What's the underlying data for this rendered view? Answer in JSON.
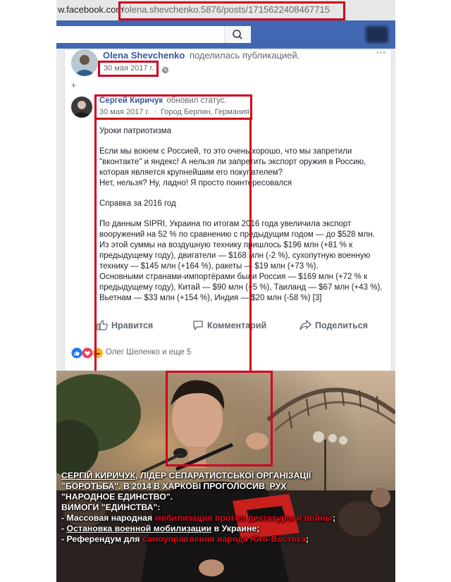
{
  "browser": {
    "url_host": "w.facebook.com",
    "url_path": "/olena.shevchenko.5876/posts/1715622408467715"
  },
  "share": {
    "author": "Olena Shevchenko",
    "action": "поделилась публикацией.",
    "date": "30 мая 2017 г.",
    "more": "···",
    "plus": "+"
  },
  "post": {
    "author": "Сергей Киричук",
    "action": "обновил статус.",
    "date": "30 мая 2017 г.",
    "separator": "·",
    "location": "Город Берлин, Германия",
    "paragraphs": [
      "Уроки патриотизма",
      "Если мы воюем с Россией, то это очень хорошо, что мы запретили \"вконтакте\" и яндекс! А нельзя ли запретить экспорт оружия в Россию, которая является крупнейшим его покупателем?\nНет, нельзя? Ну, ладно! Я просто поинтересовался",
      "Справка за 2016 год",
      "По данным SIPRI, Украина по итогам 2016 года увеличила экспорт вооружений на 52 % по сравнению с предыдущим годом — до $528 млн. Из этой суммы на воздушную технику пришлось $196 млн (+81 % к предыдущему году), двигатели — $168 млн (-2 %), сухопутную военную технику — $145 млн (+164 %), ракеты — $19 млн (+73 %).\nОсновными странами-импортёрами были Россия — $169 млн (+72 % к предыдущему году), Китай — $90 млн (+5 %), Таиланд — $67 млн (+43 %), Вьетнам — $33 млн (+154 %), Индия — $20 млн (-58 %) [3]"
    ],
    "actions": {
      "like": "Нравится",
      "comment": "Комментарий",
      "share": "Поделиться"
    },
    "reactions_text": "Олег Шеленко и еще 5"
  },
  "caption": {
    "line1_name": "СЕРГІЙ КИРИЧУК",
    "line1_rest": ", ЛІДЕР СЕПАРАТИСТСЬКОЇ ОРГАНІЗАЦІЇ",
    "line2": "\"БОРОТЬБА\". В 2014 В ХАРКОВІ ПРОГОЛОСИВ  РУХ",
    "line3": "\"НАРОДНОЕ ЕДИНСТВО\".",
    "line4": "ВИМОГИ \"ЕДИНСТВА\":",
    "d1_a": "- Массовая народная ",
    "d1_b": "мобилизация против диктатуры и войны",
    "d1_c": ";",
    "d2_a": "- ",
    "d2_b": "Остановка военной мобилизации",
    "d2_c": " в Украине;",
    "d3_a": "- Референдум для ",
    "d3_b": "самоуправления народа Юго-Востока",
    "d3_c": ";"
  },
  "colors": {
    "fb_blue": "#4267b2",
    "link": "#385898",
    "highlight_red": "#d0021b",
    "caption_red": "#e3001b"
  }
}
